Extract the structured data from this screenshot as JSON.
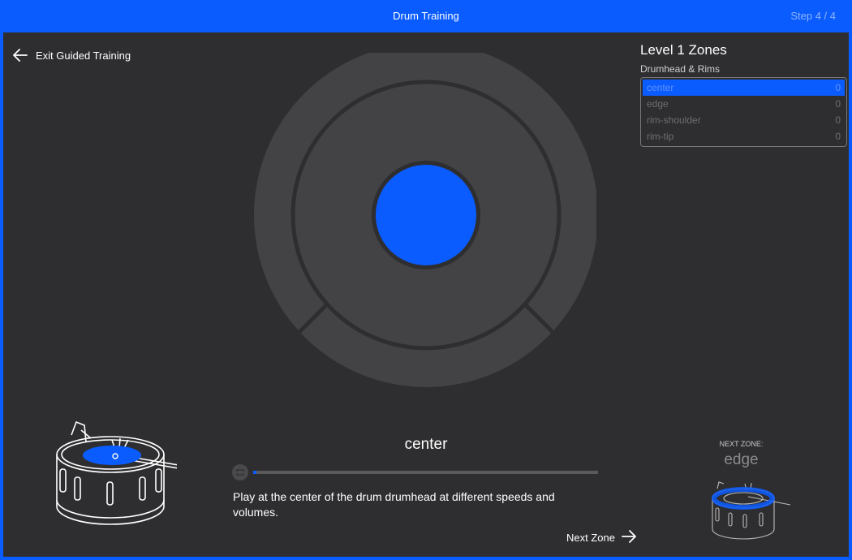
{
  "window": {
    "title": "Drum Training",
    "step": "Step 4 / 4"
  },
  "nav": {
    "exit_label": "Exit Guided Training",
    "exit_icon": "arrow-left-icon"
  },
  "zones_panel": {
    "title": "Level 1 Zones",
    "subtitle": "Drumhead & Rims",
    "items": [
      {
        "name": "center",
        "count": "0"
      },
      {
        "name": "edge",
        "count": "0"
      },
      {
        "name": "rim-shoulder",
        "count": "0"
      },
      {
        "name": "rim-tip",
        "count": "0"
      }
    ],
    "active_index": 0
  },
  "current_zone": "center",
  "progress": 0.0,
  "instruction": "Play at the center of the drum drumhead at different speeds and volumes.",
  "next_button": {
    "label": "Next Zone",
    "icon": "arrow-right-icon"
  },
  "next_zone": {
    "label": "NEXT ZONE:",
    "name": "edge"
  },
  "colors": {
    "accent": "#0a5cff",
    "background": "#2e2e30",
    "zone_fill": "#434346"
  }
}
